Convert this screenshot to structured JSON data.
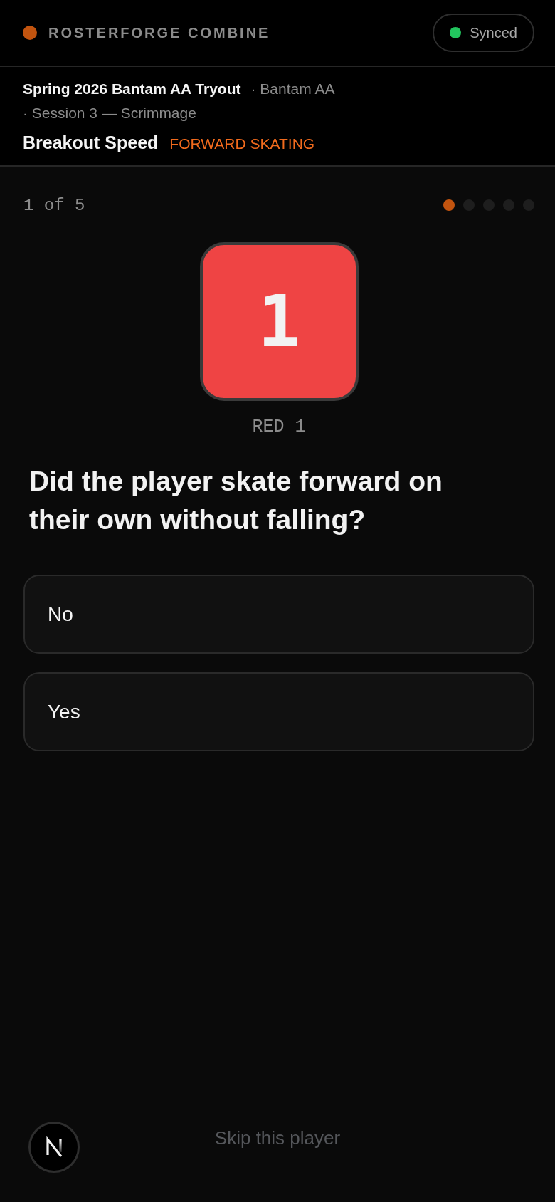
{
  "brand": {
    "title": "ROSTERFORGE COMBINE"
  },
  "sync": {
    "label": "Synced",
    "kind": "ok"
  },
  "session": {
    "event": "Spring 2026 Bantam AA Tryout",
    "group": "· Bantam AA",
    "session": "· Session 3 — Scrimmage",
    "drill": "Breakout Speed",
    "category": "FORWARD SKATING"
  },
  "progress": {
    "label": "1 of 5",
    "steps": [
      {
        "active": true
      },
      {
        "active": false
      },
      {
        "active": false
      },
      {
        "active": false
      },
      {
        "active": false
      }
    ]
  },
  "player": {
    "number": "1",
    "label": "RED 1",
    "color": "#ef4444"
  },
  "question": {
    "text": "Did the player skate forward on their own without falling?",
    "options": [
      {
        "label": "No",
        "selected": false
      },
      {
        "label": "Yes",
        "selected": false
      }
    ]
  },
  "footer": {
    "skip": "Skip this player"
  }
}
